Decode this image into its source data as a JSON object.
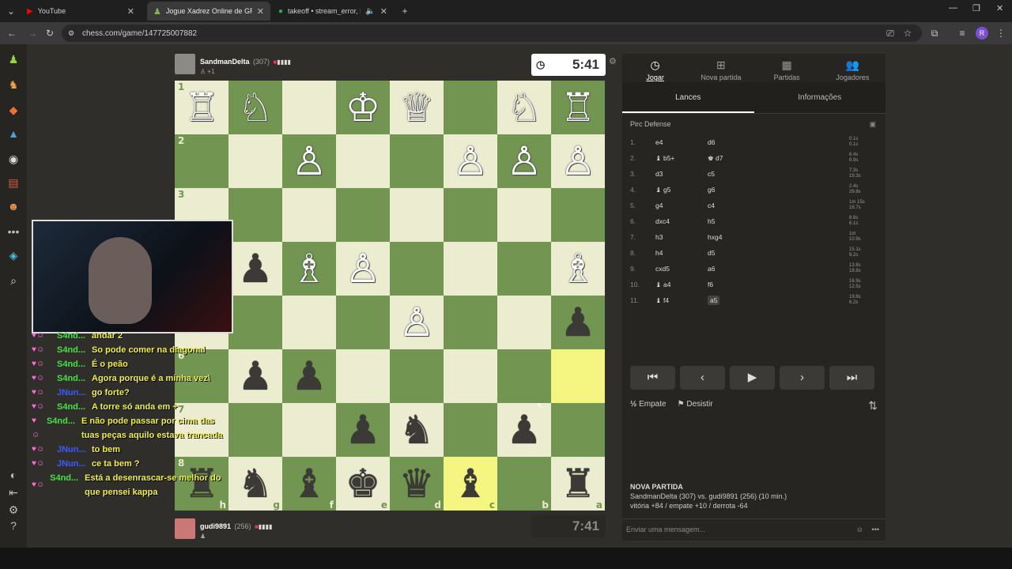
{
  "browser": {
    "tabs": [
      {
        "label": "YouTube",
        "color": "#ff0000"
      },
      {
        "label": "Jogue Xadrez Online de GRAÇA",
        "color": "#81b64c"
      },
      {
        "label": "takeoff • stream_error, Lofi",
        "color": "#1db954"
      }
    ],
    "url": "chess.com/game/147725007882",
    "profile_letter": "R"
  },
  "top_player": {
    "name": "SandmanDelta",
    "rating": "(307)",
    "sub": "+1",
    "clock": "5:41"
  },
  "bottom_player": {
    "name": "gudi9891",
    "rating": "(256)",
    "clock": "7:41"
  },
  "board": {
    "rows": [
      [
        "♖",
        "♘",
        "",
        "♔",
        "♕",
        "",
        "♘",
        "♖"
      ],
      [
        "",
        "",
        "♙",
        "",
        "",
        "♙",
        "♙",
        "♙"
      ],
      [
        "",
        "",
        "",
        "",
        "",
        "",
        "",
        ""
      ],
      [
        "",
        "♟",
        "♗",
        "♙",
        "",
        "",
        "",
        "♗"
      ],
      [
        "",
        "",
        "",
        "",
        "♙",
        "",
        "",
        "♟"
      ],
      [
        "",
        "♟",
        "♟",
        "",
        "",
        "",
        "",
        ""
      ],
      [
        "",
        "",
        "",
        "♟",
        "♞",
        "",
        "♟",
        ""
      ],
      [
        "♜",
        "♞",
        "♝",
        "♚",
        "♛",
        "♝",
        "",
        "♜"
      ]
    ],
    "ranks": [
      "1",
      "2",
      "3",
      "4",
      "5",
      "6",
      "7",
      "8"
    ],
    "files": [
      "h",
      "g",
      "f",
      "e",
      "d",
      "c",
      "b",
      "a"
    ],
    "highlight": [
      [
        5,
        7
      ],
      [
        7,
        5
      ],
      [
        4,
        7
      ]
    ]
  },
  "chat": [
    {
      "user": "S4nd...",
      "msg": "andar 2",
      "color": "#45e045"
    },
    {
      "user": "S4nd...",
      "msg": "So pode comer na diagonal",
      "color": "#45e045"
    },
    {
      "user": "S4nd...",
      "msg": "É o peão",
      "color": "#45e045"
    },
    {
      "user": "S4nd...",
      "msg": "Agora porque é a minha vez\\",
      "color": "#45e045"
    },
    {
      "user": "JNun...",
      "msg": "go forte?",
      "color": "#3a5bff"
    },
    {
      "user": "S4nd...",
      "msg": "A torre só anda em +",
      "color": "#45e045"
    },
    {
      "user": "S4nd...",
      "msg": "E não pode passar por cima das tuas peças aquilo estava trancada",
      "color": "#45e045"
    },
    {
      "user": "JNun...",
      "msg": "to bem",
      "color": "#3a5bff"
    },
    {
      "user": "JNun...",
      "msg": "ce ta bem ?",
      "color": "#3a5bff"
    },
    {
      "user": "S4nd...",
      "msg": "Está a desenrascar-se melhor do que pensei kappa",
      "color": "#45e045"
    }
  ],
  "panel": {
    "tabs": [
      {
        "label": "Jogar",
        "icon": "clock-icon"
      },
      {
        "label": "Nova partida",
        "icon": "plus-icon"
      },
      {
        "label": "Partidas",
        "icon": "board-icon"
      },
      {
        "label": "Jogadores",
        "icon": "users-icon"
      }
    ],
    "subtabs": [
      "Lances",
      "Informações"
    ],
    "opening": "Pirc Defense",
    "moves": [
      {
        "n": "1.",
        "w": "e4",
        "b": "d6",
        "tw": "0.1s",
        "tb": "0.1s"
      },
      {
        "n": "2.",
        "w": "♝ b5+",
        "b": "♚ d7",
        "tw": "8.4s",
        "tb": "8.9s"
      },
      {
        "n": "3.",
        "w": "d3",
        "b": "c5",
        "tw": "7.3s",
        "tb": "19.3s"
      },
      {
        "n": "4.",
        "w": "♝ g5",
        "b": "g6",
        "tw": "2.4s",
        "tb": "29.8s"
      },
      {
        "n": "5.",
        "w": "g4",
        "b": "c4",
        "tw": "1m 15s",
        "tb": "16.7s"
      },
      {
        "n": "6.",
        "w": "dxc4",
        "b": "h5",
        "tw": "8.8s",
        "tb": "6.1s"
      },
      {
        "n": "7.",
        "w": "h3",
        "b": "hxg4",
        "tw": "1m",
        "tb": "10.9s"
      },
      {
        "n": "8.",
        "w": "h4",
        "b": "d5",
        "tw": "15.1s",
        "tb": "9.2s"
      },
      {
        "n": "9.",
        "w": "cxd5",
        "b": "a6",
        "tw": "13.8s",
        "tb": "18.8s"
      },
      {
        "n": "10.",
        "w": "♝ a4",
        "b": "f6",
        "tw": "16.9s",
        "tb": "12.5s"
      },
      {
        "n": "11.",
        "w": "♝ f4",
        "b": "a5",
        "tw": "19.8s",
        "tb": "6.2s"
      }
    ],
    "draw": "Empate",
    "resign": "Desistir",
    "new_game_title": "NOVA PARTIDA",
    "new_game_line1": "SandmanDelta (307) vs. gudi9891 (256) (10 min.)",
    "new_game_line2": "vitória +84 / empate +10 / derrota -64",
    "message_placeholder": "Enviar uma mensagem..."
  }
}
